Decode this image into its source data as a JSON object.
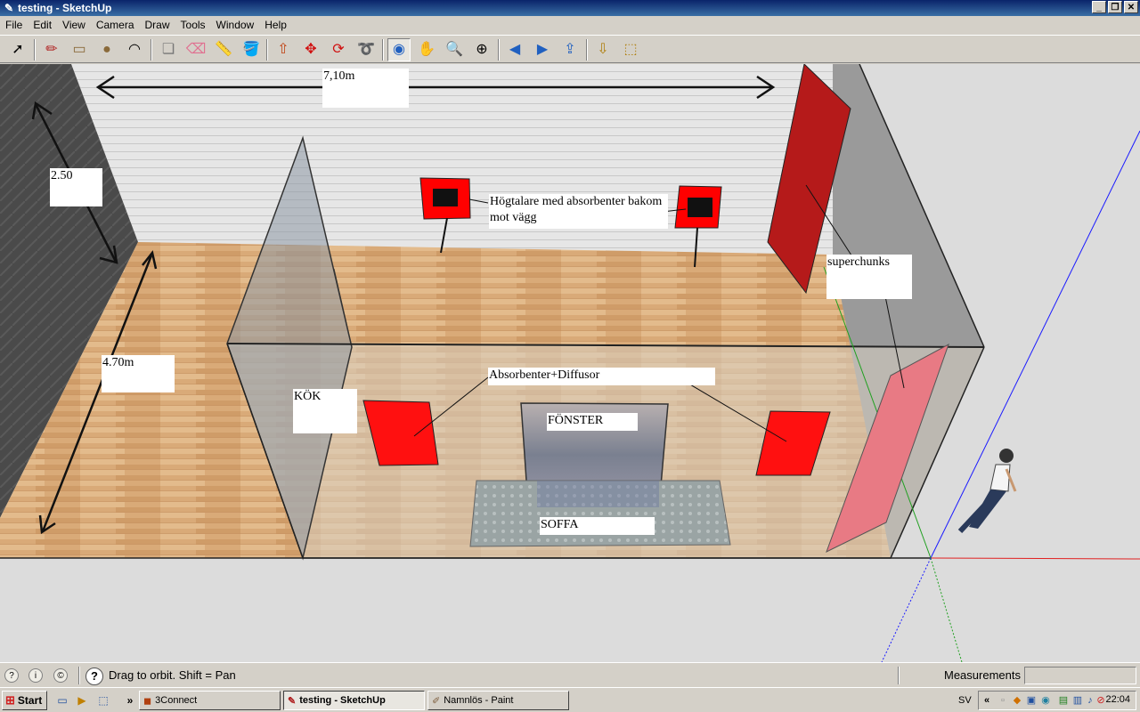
{
  "window": {
    "title": "testing - SketchUp",
    "controls": [
      "_",
      "❐",
      "✕"
    ]
  },
  "menu": [
    "File",
    "Edit",
    "View",
    "Camera",
    "Draw",
    "Tools",
    "Window",
    "Help"
  ],
  "toolbar": {
    "tools": [
      {
        "name": "select-tool",
        "glyph": "➚"
      },
      {
        "name": "pencil-tool",
        "glyph": "✏"
      },
      {
        "name": "rectangle-tool",
        "glyph": "▭"
      },
      {
        "name": "circle-tool",
        "glyph": "●"
      },
      {
        "name": "arc-tool",
        "glyph": "◠"
      },
      {
        "name": "make-component-tool",
        "glyph": "❏"
      },
      {
        "name": "eraser-tool",
        "glyph": "⌫"
      },
      {
        "name": "tape-measure-tool",
        "glyph": "📏"
      },
      {
        "name": "paint-bucket-tool",
        "glyph": "🪣"
      },
      {
        "name": "push-pull-tool",
        "glyph": "⇧"
      },
      {
        "name": "move-tool",
        "glyph": "✥"
      },
      {
        "name": "rotate-tool",
        "glyph": "⟳"
      },
      {
        "name": "follow-me-tool",
        "glyph": "➰"
      },
      {
        "name": "orbit-tool",
        "glyph": "◉"
      },
      {
        "name": "pan-tool",
        "glyph": "✋"
      },
      {
        "name": "zoom-tool",
        "glyph": "🔍"
      },
      {
        "name": "zoom-extents-tool",
        "glyph": "⊕"
      },
      {
        "name": "previous-view-tool",
        "glyph": "◀"
      },
      {
        "name": "next-view-tool",
        "glyph": "▶"
      },
      {
        "name": "get-models-tool",
        "glyph": "⇪"
      },
      {
        "name": "share-model-tool",
        "glyph": "⇩"
      },
      {
        "name": "get-photo-texture-tool",
        "glyph": "⬚"
      },
      {
        "name": "export-tool",
        "glyph": "⇲"
      }
    ],
    "active_tool": "orbit-tool"
  },
  "model": {
    "labels": {
      "width": "7,10m",
      "height": "2.50",
      "depth": "4.70m",
      "speakers": "Högtalare med absorbenter bakom mot vägg",
      "superchunks": "superchunks",
      "absorbers": "Absorbenter+Diffusor",
      "kitchen": "KÖK",
      "window": "FÖNSTER",
      "sofa": "SOFFA"
    },
    "colors": {
      "panel_red": "#ff0000",
      "dark_red": "#b01010",
      "floor": "#d8a870",
      "wall": "#c8c8c8"
    }
  },
  "status": {
    "hint": "Drag to orbit.  Shift = Pan",
    "help_glyph": "?",
    "measurements_label": "Measurements",
    "measurements_value": ""
  },
  "taskbar": {
    "start": "Start",
    "tasks": [
      {
        "label": "3Connect",
        "active": false
      },
      {
        "label": "testing - SketchUp",
        "active": true
      },
      {
        "label": "Namnlös - Paint",
        "active": false
      }
    ],
    "language": "SV",
    "time": "22:04"
  }
}
